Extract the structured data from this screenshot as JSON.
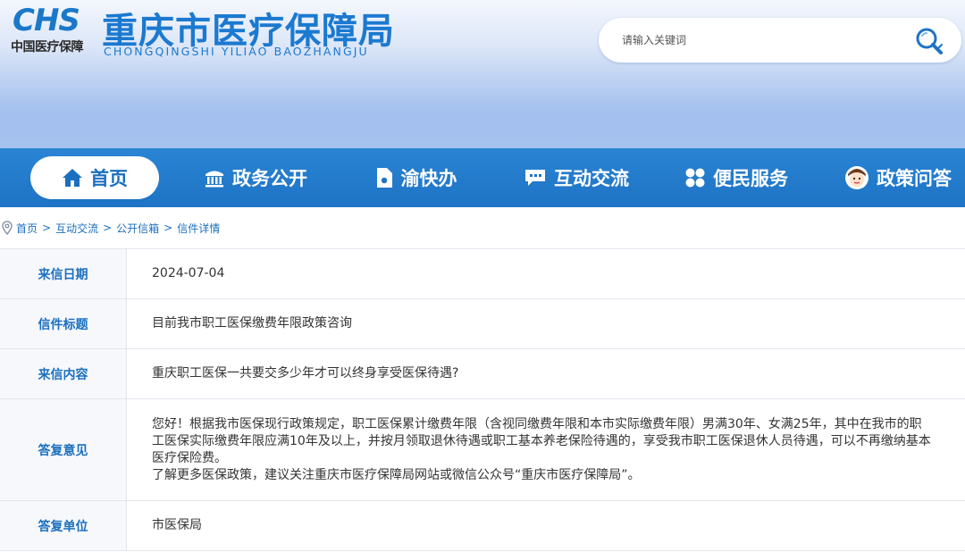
{
  "header": {
    "logo_text": "CHS",
    "logo_sub": "中国医疗保障",
    "site_title": "重庆市医疗保障局",
    "site_pinyin": "CHONGQINGSHI  YILIAO  BAOZHANGJU"
  },
  "search": {
    "placeholder": "请输入关键词",
    "icon": "search-icon"
  },
  "colors": {
    "accent": "#1e73c4",
    "label_text": "#1b6fbf"
  },
  "nav": {
    "items": [
      {
        "label": "首页",
        "icon": "home-icon",
        "active": true
      },
      {
        "label": "政务公开",
        "icon": "government-building-icon",
        "active": false
      },
      {
        "label": "渝快办",
        "icon": "document-icon",
        "active": false
      },
      {
        "label": "互动交流",
        "icon": "chat-bubble-icon",
        "active": false
      },
      {
        "label": "便民服务",
        "icon": "grid-dots-icon",
        "active": false
      },
      {
        "label": "政策问答",
        "icon": "avatar-face-icon",
        "active": false
      }
    ]
  },
  "breadcrumb": {
    "icon": "location-pin-icon",
    "items": [
      "首页",
      "互动交流",
      "公开信箱",
      "信件详情"
    ],
    "separator": ">"
  },
  "letter": {
    "date_label": "来信日期",
    "date_value": "2024-07-04",
    "title_label": "信件标题",
    "title_value": "目前我市职工医保缴费年限政策咨询",
    "content_label": "来信内容",
    "content_value": "重庆职工医保一共要交多少年才可以终身享受医保待遇?",
    "reply_label": "答复意见",
    "reply_paragraph_1": "您好！根据我市医保现行政策规定，职工医保累计缴费年限（含视同缴费年限和本市实际缴费年限）男满30年、女满25年，其中在我市的职工医保实际缴费年限应满10年及以上，并按月领取退休待遇或职工基本养老保险待遇的，享受我市职工医保退休人员待遇，可以不再缴纳基本医疗保险费。",
    "reply_paragraph_2": "了解更多医保政策，建议关注重庆市医疗保障局网站或微信公众号“重庆市医疗保障局”。",
    "unit_label": "答复单位",
    "unit_value": "市医保局"
  }
}
